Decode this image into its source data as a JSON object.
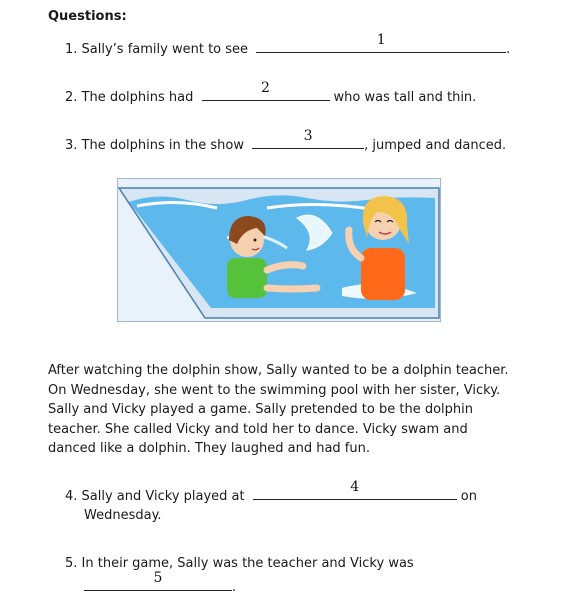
{
  "heading": "Questions:",
  "questions": [
    {
      "pre": "1. Sally’s family went to see",
      "num": "1",
      "post": "."
    },
    {
      "pre": "2. The dolphins had",
      "num": "2",
      "post": "who was tall and thin."
    },
    {
      "pre": "3. The dolphins in the show",
      "num": "3",
      "post": ", jumped and danced."
    },
    {
      "pre": "4. Sally and Vicky played at",
      "num": "4",
      "post": "on",
      "line2": "Wednesday."
    },
    {
      "pre": "5. In their game, Sally was the teacher and Vicky was",
      "num": "5",
      "post": "."
    }
  ],
  "passage": "After watching the dolphin show, Sally wanted to be a dolphin teacher.  On Wednesday, she went to the swimming pool with her sister, Vicky.  Sally and Vicky played a game.  Sally pretended to be the dolphin teacher.  She called Vicky and told her to dance.  Vicky swam and danced like a dolphin.  They laughed and had fun.",
  "colors": {
    "water": "#5db8ec",
    "pool_edge": "#4a7fb0",
    "vest_green": "#56c23c",
    "vest_orange": "#ff6a1a",
    "hair_brown": "#8a4a1e",
    "hair_blonde": "#f2c24a"
  }
}
